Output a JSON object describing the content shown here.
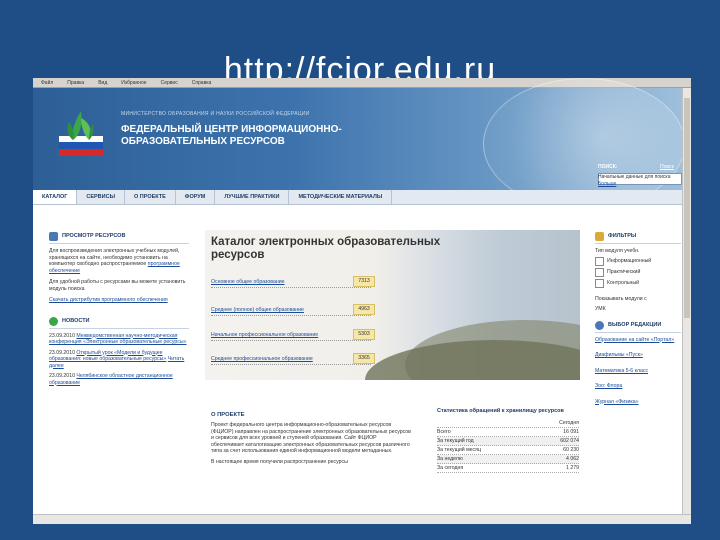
{
  "slide_title": "http://fcior.edu.ru",
  "browser": {
    "menu": [
      "Файл",
      "Правка",
      "Вид",
      "Избранное",
      "Сервис",
      "Справка"
    ]
  },
  "header": {
    "ministry": "МИНИСТЕРСТВО ОБРАЗОВАНИЯ И НАУКИ РОССИЙСКОЙ ФЕДЕРАЦИИ",
    "org_name": "ФЕДЕРАЛЬНЫЙ ЦЕНТР ИНФОРМАЦИОННО-ОБРАЗОВАТЕЛЬНЫХ РЕСУРСОВ",
    "search_label": "ПОИСК:",
    "search_link": "Поиск",
    "search_value": "",
    "search_hint": "Начальные данные для поиска",
    "search_hint_link": "Больше"
  },
  "nav": [
    "КАТАЛОГ",
    "СЕРВИСЫ",
    "О ПРОЕКТЕ",
    "ФОРУМ",
    "ЛУЧШИЕ ПРАКТИКИ",
    "МЕТОДИЧЕСКИЕ МАТЕРИАЛЫ"
  ],
  "left": {
    "viewer_title": "ПРОСМОТР РЕСУРСОВ",
    "viewer_text": "Для воспроизведения электронных учебных модулей, хранящихся на сайте, необходимо установить на компьютер свободно распространяемое",
    "viewer_link": "программное обеспечение",
    "viewer_text2": "Для удобной работы с ресурсами вы можете установить модуль поиска",
    "viewer_link2": "Скачать дистрибутив программного обеспечения",
    "news_title": "НОВОСТИ",
    "news": [
      {
        "date": "23.09.2010",
        "text": "Межведомственная научно-методическая конференция «Электронные образовательные ресурсы»"
      },
      {
        "date": "23.09.2010",
        "text": "Открытый урок «Модели и будущее образования: новые образовательные ресурсы»"
      },
      {
        "date": "23.09.2010",
        "text": "Челябинское областное дистанционное образование"
      }
    ],
    "news_more": "Читать далее"
  },
  "catalog": {
    "title": "Каталог электронных образовательных ресурсов",
    "rows": [
      {
        "label": "Основное общее образование",
        "count": "7313"
      },
      {
        "label": "Среднее (полное) общее образование",
        "count": "4963"
      },
      {
        "label": "Начальное профессиональное образование",
        "count": "5303"
      },
      {
        "label": "Среднее профессиональное образование",
        "count": "3365"
      }
    ]
  },
  "about": {
    "title": "О ПРОЕКТЕ",
    "text": "Проект федерального центра информационно-образовательных ресурсов (ФЦИОР) направлен на распространение электронных образовательных ресурсов и сервисов для всех уровней и ступеней образования. Сайт ФЦИОР обеспечивает каталогизацию электронных образовательных ресурсов различного типа за счет использования единой информационной модели метаданных.",
    "text2": "В настоящее время получили распространение ресурсы"
  },
  "stats": {
    "title": "Статистика обращений к хранилищу ресурсов",
    "header": "Сегодня",
    "rows": [
      {
        "label": "Всего",
        "value": "16 091"
      },
      {
        "label": "За текущий год",
        "value": "602 074"
      },
      {
        "label": "За текущий месяц",
        "value": "60 230"
      },
      {
        "label": "За неделю",
        "value": "4 062"
      },
      {
        "label": "За сегодня",
        "value": "1 279"
      }
    ]
  },
  "right": {
    "filters_title": "ФИЛЬТРЫ",
    "filter_hint": "Тип модуля учебн.",
    "filters": [
      "Информационный",
      "Практический",
      "Контрольный"
    ],
    "filter_note": "Показывать модули с",
    "filter_note2": "УМК",
    "editor_title": "ВЫБОР РЕДАКЦИИ",
    "editor_items": [
      "Образование на сайте «Портал»",
      "Диафильмы «Пуск»",
      "Математика 5-6 класс",
      "Зоо: Флора",
      "Журнал «Физика»"
    ]
  }
}
